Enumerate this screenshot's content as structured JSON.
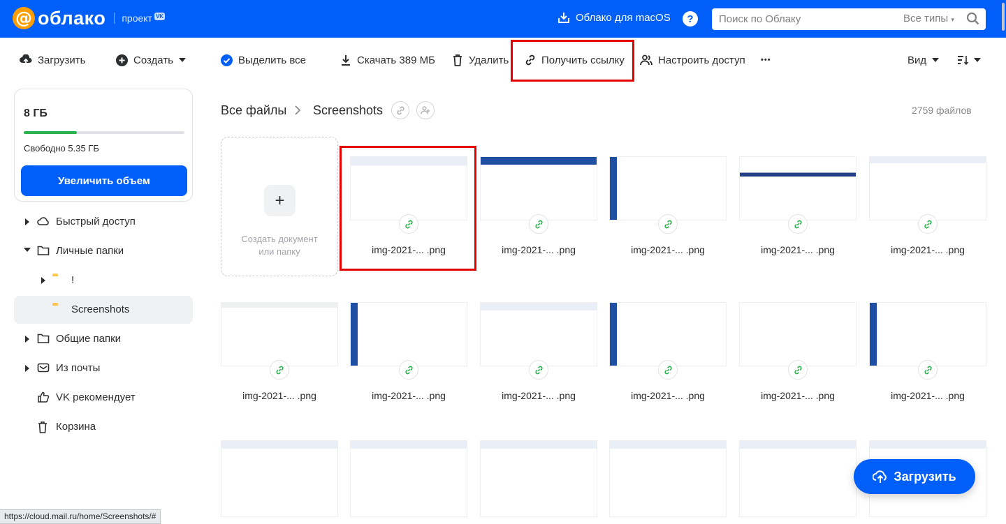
{
  "header": {
    "logo_text": "облако",
    "project_label": "проект",
    "vk_badge": "VK",
    "mac_link": "Облако для macOS",
    "help_label": "?",
    "search": {
      "placeholder": "Поиск по Облаку",
      "types_label": "Все типы"
    }
  },
  "toolbar": {
    "upload": "Загрузить",
    "create": "Создать",
    "select_all": "Выделить все",
    "download": "Скачать 389 МБ",
    "delete": "Удалить",
    "get_link": "Получить ссылку",
    "share_access": "Настроить доступ",
    "more": "•••",
    "view": "Вид"
  },
  "storage": {
    "total": "8 ГБ",
    "free": "Свободно 5.35 ГБ",
    "used_fraction": 0.33,
    "increase_button": "Увеличить объем"
  },
  "sidebar": {
    "items": [
      {
        "label": "Быстрый доступ"
      },
      {
        "label": "Личные папки"
      },
      {
        "label": "!"
      },
      {
        "label": "Screenshots"
      },
      {
        "label": "Общие папки"
      },
      {
        "label": "Из почты"
      },
      {
        "label": "VK рекомендует"
      },
      {
        "label": "Корзина"
      }
    ]
  },
  "breadcrumb": {
    "root": "Все файлы",
    "current": "Screenshots"
  },
  "file_count": "2759 файлов",
  "create_card": {
    "plus": "+",
    "label_line1": "Создать документ",
    "label_line2": "или папку"
  },
  "files": [
    {
      "name": "img-2021-...  .png"
    },
    {
      "name": "img-2021-...  .png"
    },
    {
      "name": "img-2021-...  .png"
    },
    {
      "name": "img-2021-...  .png"
    },
    {
      "name": "img-2021-...  .png"
    },
    {
      "name": "img-2021-...  .png"
    },
    {
      "name": "img-2021-...  .png"
    },
    {
      "name": "img-2021-...  .png"
    },
    {
      "name": "img-2021-...  .png"
    },
    {
      "name": "img-2021-...  .png"
    },
    {
      "name": "img-2021-...  .png"
    }
  ],
  "fab_upload": "Загрузить",
  "status_url": "https://cloud.mail.ru/home/Screenshots/#",
  "colors": {
    "brand": "#005ff9",
    "highlight": "#e30000",
    "link_green": "#2bb24c",
    "folder": "#ffc54d"
  }
}
